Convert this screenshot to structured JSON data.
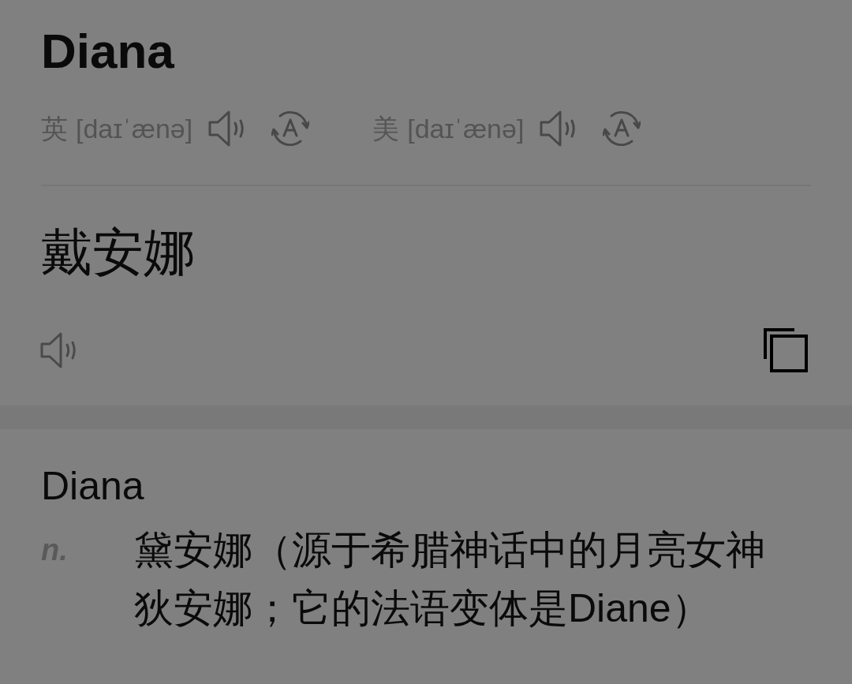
{
  "headword": {
    "text": "Diana"
  },
  "pronunciations": [
    {
      "region": "英",
      "phonetic": "[daɪˈænə]"
    },
    {
      "region": "美",
      "phonetic": "[daɪˈænə]"
    }
  ],
  "translation": {
    "text": "戴安娜"
  },
  "dictionary": {
    "entry": "Diana",
    "senses": [
      {
        "pos": "n.",
        "definition": "黛安娜（源于希腊神话中的月亮女神狄安娜；它的法语变体是Diane）"
      }
    ]
  }
}
